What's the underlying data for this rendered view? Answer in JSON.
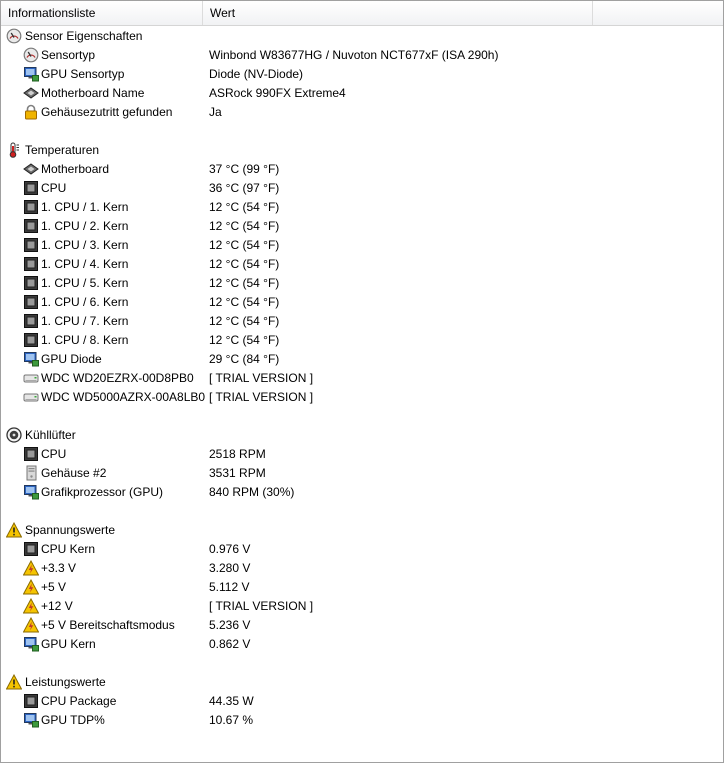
{
  "columns": {
    "info": "Informationsliste",
    "value": "Wert"
  },
  "colors": {
    "header_border": "#d5d5d5",
    "chip_dark": "#3a3a3a",
    "monitor_blue": "#2a63c2",
    "warning_yellow": "#f5c400"
  },
  "groups": [
    {
      "title": "Sensor Eigenschaften",
      "icon": "gauge-icon",
      "items": [
        {
          "label": "Sensortyp",
          "value": "Winbond W83677HG / Nuvoton NCT677xF  (ISA 290h)",
          "icon": "gauge-icon"
        },
        {
          "label": "GPU Sensortyp",
          "value": "Diode  (NV-Diode)",
          "icon": "monitor-icon"
        },
        {
          "label": "Motherboard Name",
          "value": "ASRock 990FX Extreme4",
          "icon": "motherboard-icon"
        },
        {
          "label": "Gehäusezutritt gefunden",
          "value": "Ja",
          "icon": "lock-icon"
        }
      ]
    },
    {
      "title": "Temperaturen",
      "icon": "thermometer-icon",
      "items": [
        {
          "label": "Motherboard",
          "value": "37 °C  (99 °F)",
          "icon": "motherboard-icon"
        },
        {
          "label": "CPU",
          "value": "36 °C  (97 °F)",
          "icon": "cpu-icon"
        },
        {
          "label": "1. CPU / 1. Kern",
          "value": "12 °C  (54 °F)",
          "icon": "cpu-icon"
        },
        {
          "label": "1. CPU / 2. Kern",
          "value": "12 °C  (54 °F)",
          "icon": "cpu-icon"
        },
        {
          "label": "1. CPU / 3. Kern",
          "value": "12 °C  (54 °F)",
          "icon": "cpu-icon"
        },
        {
          "label": "1. CPU / 4. Kern",
          "value": "12 °C  (54 °F)",
          "icon": "cpu-icon"
        },
        {
          "label": "1. CPU / 5. Kern",
          "value": "12 °C  (54 °F)",
          "icon": "cpu-icon"
        },
        {
          "label": "1. CPU / 6. Kern",
          "value": "12 °C  (54 °F)",
          "icon": "cpu-icon"
        },
        {
          "label": "1. CPU / 7. Kern",
          "value": "12 °C  (54 °F)",
          "icon": "cpu-icon"
        },
        {
          "label": "1. CPU / 8. Kern",
          "value": "12 °C  (54 °F)",
          "icon": "cpu-icon"
        },
        {
          "label": "GPU Diode",
          "value": "29 °C  (84 °F)",
          "icon": "monitor-icon"
        },
        {
          "label": "WDC WD20EZRX-00D8PB0",
          "value": "[ TRIAL VERSION ]",
          "icon": "hard-drive-icon"
        },
        {
          "label": "WDC WD5000AZRX-00A8LB0",
          "value": "[ TRIAL VERSION ]",
          "icon": "hard-drive-icon"
        }
      ]
    },
    {
      "title": "Kühllüfter",
      "icon": "fan-icon",
      "items": [
        {
          "label": "CPU",
          "value": "2518 RPM",
          "icon": "cpu-icon"
        },
        {
          "label": "Gehäuse #2",
          "value": "3531 RPM",
          "icon": "case-icon"
        },
        {
          "label": "Grafikprozessor (GPU)",
          "value": "840 RPM  (30%)",
          "icon": "monitor-icon"
        }
      ]
    },
    {
      "title": "Spannungswerte",
      "icon": "warning-icon",
      "items": [
        {
          "label": "CPU Kern",
          "value": "0.976 V",
          "icon": "cpu-icon"
        },
        {
          "label": "+3.3 V",
          "value": "3.280 V",
          "icon": "voltage-icon"
        },
        {
          "label": "+5 V",
          "value": "5.112 V",
          "icon": "voltage-icon"
        },
        {
          "label": "+12 V",
          "value": "[ TRIAL VERSION ]",
          "icon": "voltage-icon"
        },
        {
          "label": "+5 V Bereitschaftsmodus",
          "value": "5.236 V",
          "icon": "voltage-icon"
        },
        {
          "label": "GPU Kern",
          "value": "0.862 V",
          "icon": "monitor-icon"
        }
      ]
    },
    {
      "title": "Leistungswerte",
      "icon": "warning-icon",
      "items": [
        {
          "label": "CPU Package",
          "value": "44.35 W",
          "icon": "cpu-icon"
        },
        {
          "label": "GPU TDP%",
          "value": "10.67 %",
          "icon": "monitor-icon"
        }
      ]
    }
  ]
}
